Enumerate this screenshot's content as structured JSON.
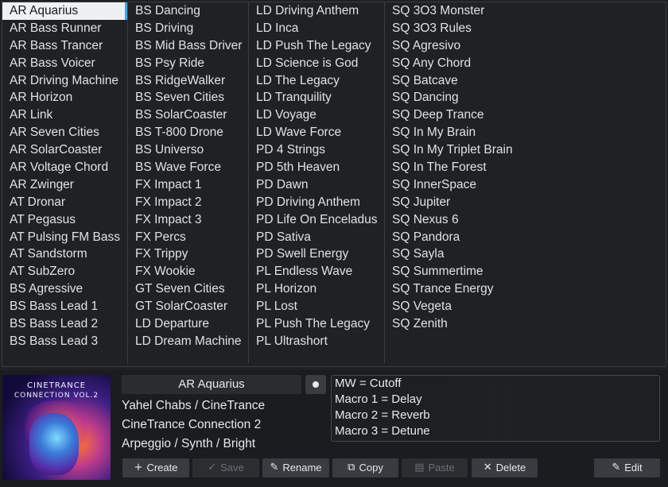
{
  "presets": {
    "columns": [
      [
        "AR Aquarius",
        "AR Bass Runner",
        "AR Bass Trancer",
        "AR Bass Voicer",
        "AR Driving Machine",
        "AR Horizon",
        "AR Link",
        "AR Seven Cities",
        "AR SolarCoaster",
        "AR Voltage Chord",
        "AR Zwinger",
        "AT Dronar",
        "AT Pegasus",
        "AT Pulsing FM Bass",
        "AT Sandstorm",
        "AT SubZero",
        "BS Agressive",
        "BS Bass Lead 1",
        "BS Bass Lead 2",
        "BS Bass Lead 3"
      ],
      [
        "BS Dancing",
        "BS Driving",
        "BS Mid Bass Driver",
        "BS Psy Ride",
        "BS RidgeWalker",
        "BS Seven Cities",
        "BS SolarCoaster",
        "BS T-800 Drone",
        "BS Universo",
        "BS Wave Force",
        "FX Impact 1",
        "FX Impact 2",
        "FX Impact 3",
        "FX Percs",
        "FX Trippy",
        "FX Wookie",
        "GT Seven Cities",
        "GT SolarCoaster",
        "LD Departure",
        "LD Dream Machine"
      ],
      [
        "LD Driving Anthem",
        "LD Inca",
        "LD Push The Legacy",
        "LD Science is God",
        "LD The Legacy",
        "LD Tranquility",
        "LD Voyage",
        "LD Wave Force",
        "PD 4 Strings",
        "PD 5th Heaven",
        "PD Dawn",
        "PD Driving Anthem",
        "PD Life On Enceladus",
        "PD Sativa",
        "PD Swell Energy",
        "PL Endless Wave",
        "PL Horizon",
        "PL Lost",
        "PL Push The Legacy",
        "PL Ultrashort"
      ],
      [
        "SQ 3O3 Monster",
        "SQ 3O3 Rules",
        "SQ Agresivo",
        "SQ Any Chord",
        "SQ Batcave",
        "SQ Dancing",
        "SQ Deep Trance",
        "SQ In My Brain",
        "SQ In My Triplet Brain",
        "SQ In The Forest",
        "SQ InnerSpace",
        "SQ Jupiter",
        "SQ Nexus 6",
        "SQ Pandora",
        "SQ Sayla",
        "SQ Summertime",
        "SQ Trance Energy",
        "SQ Vegeta",
        "SQ Zenith"
      ]
    ],
    "selected": "AR Aquarius"
  },
  "cover": {
    "line1": "CINETRANCE",
    "line2": "CONNECTION VOL.2"
  },
  "info": {
    "preset_name": "AR Aquarius",
    "author": "Yahel Chabs / CineTrance",
    "bank": "CineTrance Connection 2",
    "tags": "Arpeggio / Synth / Bright"
  },
  "macros": [
    "MW = Cutoff",
    "Macro 1 = Delay",
    "Macro 2 = Reverb",
    "Macro 3 = Detune"
  ],
  "toolbar": {
    "create": "Create",
    "save": "Save",
    "rename": "Rename",
    "copy": "Copy",
    "paste": "Paste",
    "delete": "Delete",
    "edit": "Edit"
  },
  "colors": {
    "accent": "#4aa3df",
    "selected_bg": "#eef1f4"
  }
}
